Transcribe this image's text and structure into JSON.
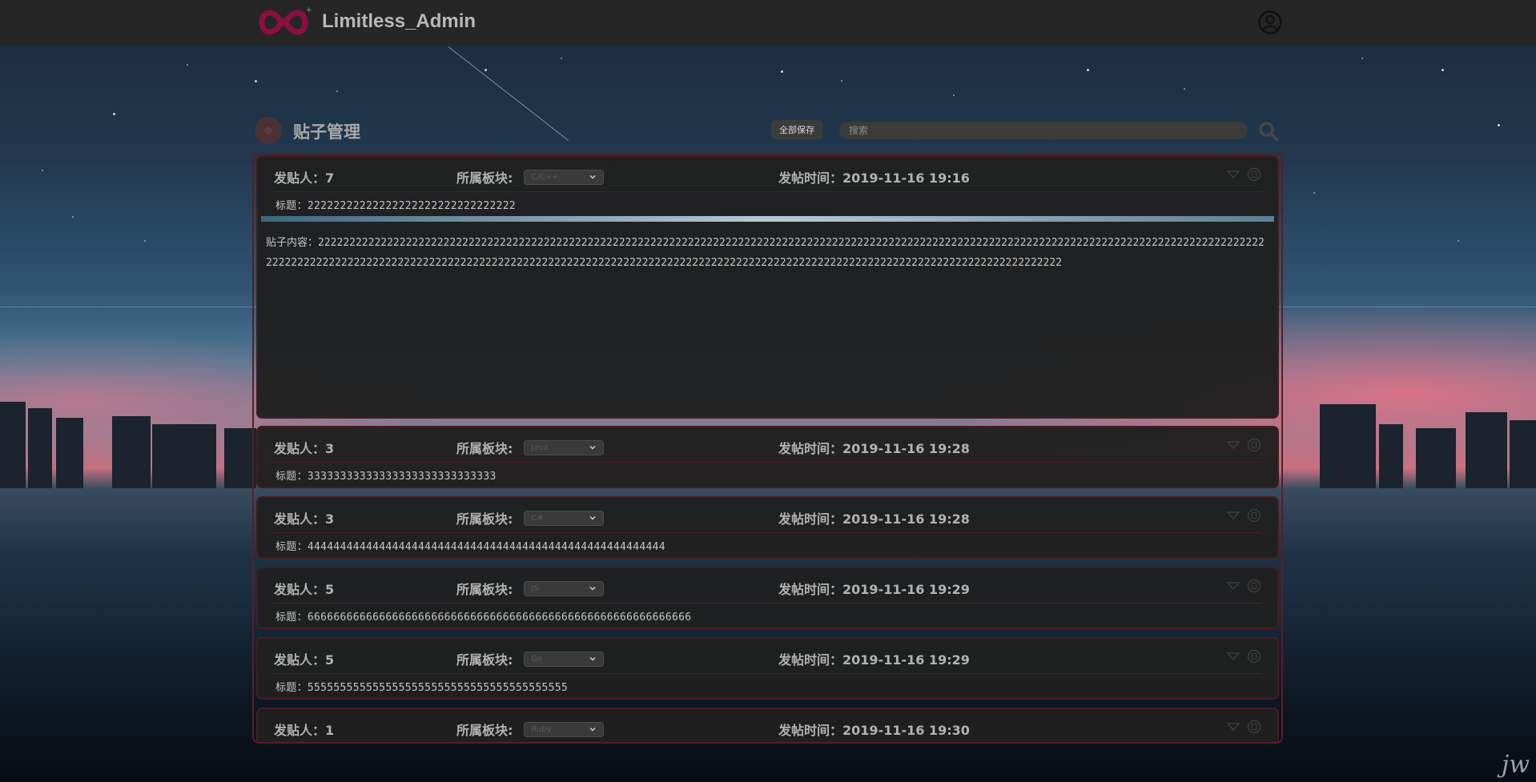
{
  "app": {
    "title": "Limitless_Admin"
  },
  "page": {
    "title": "贴子管理"
  },
  "toolbar": {
    "save_all_label": "全部保存",
    "search_placeholder": "搜索"
  },
  "labels": {
    "author": "发贴人：",
    "board": "所属板块:",
    "time": "发帖时间：",
    "title": "标题：",
    "content": "贴子内容："
  },
  "posts": [
    {
      "author": "7",
      "board": "C/C++",
      "time": "2019-11-16 19:16",
      "title": "22222222222222222222222222222222",
      "expanded": true,
      "content": "22222222222222222222222222222222222222222222222222222222222222222222222222222222222222222222222222222222222222222222222222222222222222222222222222222222222222222222222222222222222222222222222222222222222222222222222222222222222222222222222222222222222222222222222222222222222222"
    },
    {
      "author": "3",
      "board": "Java",
      "time": "2019-11-16 19:28",
      "title": "33333333333333333333333333333"
    },
    {
      "author": "3",
      "board": "C#",
      "time": "2019-11-16 19:28",
      "title": "4444444444444444444444444444444444444444444444444444444"
    },
    {
      "author": "5",
      "board": "JS",
      "time": "2019-11-16 19:29",
      "title": "66666666666666666666666666666666666666666666666666666666666"
    },
    {
      "author": "5",
      "board": "Go",
      "time": "2019-11-16 19:29",
      "title": "5555555555555555555555555555555555555555"
    },
    {
      "author": "1",
      "board": "Ruby",
      "time": "2019-11-16 19:30",
      "title": ""
    }
  ],
  "icons": {
    "logo": "infinity-logo-icon",
    "user": "user-circle-icon",
    "search": "search-icon",
    "expand": "triangle-down-icon",
    "delete": "circle-delete-icon"
  },
  "colors": {
    "accent": "#8a1040",
    "border": "#5a1e24",
    "panel": "#202020"
  },
  "signature": "jw"
}
